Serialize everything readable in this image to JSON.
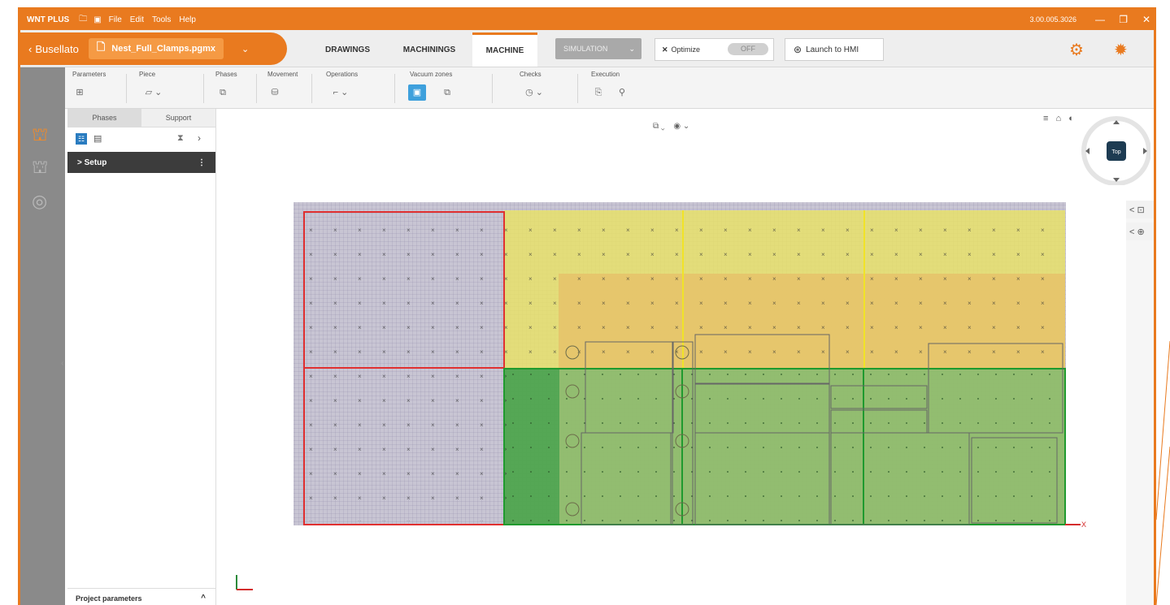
{
  "titlebar": {
    "app_name": "WNT PLUS",
    "menus": [
      "File",
      "Edit",
      "Tools",
      "Help"
    ],
    "version": "3.00.005.3026",
    "minimize": "—",
    "maximize": "❐",
    "close": "✕"
  },
  "nav": {
    "back_label": "Busellato",
    "file_name": "Nest_Full_Clamps.pgmx",
    "tabs": [
      "DRAWINGS",
      "MACHININGS",
      "MACHINE"
    ],
    "active_tab": "MACHINE",
    "select_value": "SIMULATION",
    "optimize_label": "Optimize",
    "optimize_toggle": "OFF",
    "launch_label": "Launch to HMI"
  },
  "ribbon": {
    "groups": [
      {
        "label": "Parameters",
        "icon": "⊞"
      },
      {
        "label": "Piece",
        "icon": "▱ ⌄"
      },
      {
        "label": "Phases",
        "icon": "⧉"
      },
      {
        "label": "Movement",
        "icon": "⛁"
      },
      {
        "label": "Operations",
        "icon": "⌐ ⌄"
      },
      {
        "label": "Vacuum zones",
        "icon": "▣"
      },
      {
        "label": "Checks",
        "icon": "◷ ⌄"
      },
      {
        "label": "Execution",
        "icon": "⎘"
      }
    ]
  },
  "panel": {
    "tabs": [
      "Phases",
      "Support"
    ],
    "active_tab": "Phases",
    "setup_label": "> Setup",
    "setup_menu": "⋮",
    "project_params": "Project parameters",
    "project_params_chevron": "^"
  },
  "viewport": {
    "view_controls": [
      "⧉ ⌄",
      "◉ ⌄"
    ],
    "right_tools": [
      "≡",
      "⌂",
      "◐"
    ],
    "cube_label": "Top",
    "side_buttons": [
      "< ⊡",
      "< ⊕"
    ],
    "x_axis_label": "X"
  },
  "colors": {
    "accent": "#e97a1f",
    "left_zone": "#c9c4d2",
    "yellow_zone": "#e8e06a",
    "orange_zone": "#e6c26a",
    "green_zone": "#8fbd6a",
    "dark_green_zone": "#4fa54e",
    "red_outline": "#e03030",
    "green_outline": "#1f9a2e"
  }
}
